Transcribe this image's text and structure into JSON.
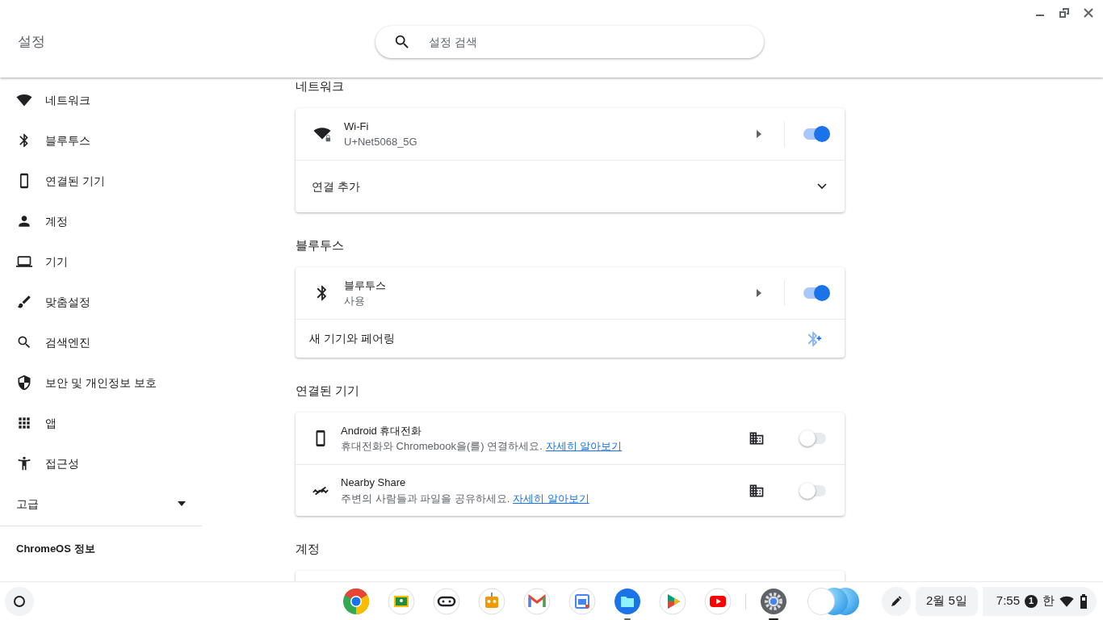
{
  "window": {
    "title": "설정"
  },
  "search": {
    "placeholder": "설정 검색"
  },
  "sidebar": {
    "items": [
      {
        "label": "네트워크"
      },
      {
        "label": "블루투스"
      },
      {
        "label": "연결된 기기"
      },
      {
        "label": "계정"
      },
      {
        "label": "기기"
      },
      {
        "label": "맞춤설정"
      },
      {
        "label": "검색엔진"
      },
      {
        "label": "보안 및 개인정보 보호"
      },
      {
        "label": "앱"
      },
      {
        "label": "접근성"
      }
    ],
    "advanced": {
      "label": "고급",
      "expanded": false
    },
    "about": "ChromeOS 정보"
  },
  "sections": [
    {
      "heading": "네트워크",
      "rows": [
        {
          "kind": "toggle",
          "title": "Wi-Fi",
          "subtitle": "U+Net5068_5G",
          "on": true
        },
        {
          "kind": "expand",
          "title": "연결 추가",
          "expanded": false
        }
      ]
    },
    {
      "heading": "블루투스",
      "rows": [
        {
          "kind": "toggle",
          "title": "블루투스",
          "subtitle": "사용",
          "on": true
        },
        {
          "kind": "action",
          "title": "새 기기와 페어링"
        }
      ]
    },
    {
      "heading": "연결된 기기",
      "rows": [
        {
          "kind": "device",
          "title": "Android 휴대전화",
          "description": "휴대전화와 Chromebook을(를) 연결하세요.",
          "link": "자세히 알아보기",
          "on": false
        },
        {
          "kind": "device",
          "title": "Nearby Share",
          "description": "주변의 사람들과 파일을 공유하세요.",
          "link": "자세히 알아보기",
          "on": false
        }
      ]
    },
    {
      "heading": "계정"
    }
  ],
  "shelf": {
    "apps": [
      {
        "running": false
      },
      {
        "running": false
      },
      {
        "running": false
      },
      {
        "running": false
      },
      {
        "running": false
      },
      {
        "running": false
      },
      {
        "running": true,
        "focused": false
      },
      {
        "running": false
      },
      {
        "running": false
      },
      {
        "running": true,
        "focused": true
      }
    ],
    "date": "2월 5일",
    "time": "7:55",
    "notification_count": "1",
    "ime": "한"
  }
}
